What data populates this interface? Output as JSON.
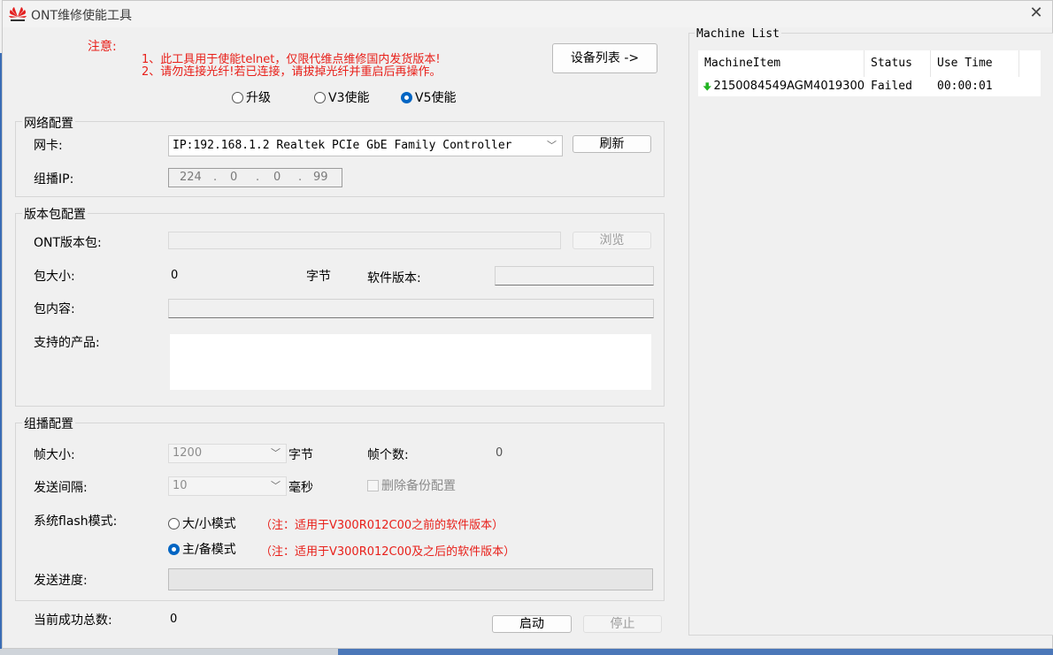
{
  "window": {
    "title": "ONT维修使能工具",
    "brand_color": "#e41e1e"
  },
  "notice": {
    "label": "注意:",
    "line1": "1、此工具用于使能telnet，仅限代维点维修国内发货版本!",
    "line2": "2、请勿连接光纤!若已连接，请拔掉光纤并重启后再操作。"
  },
  "device_list_button": "设备列表 ->",
  "mode": {
    "options": [
      "升级",
      "V3使能",
      "V5使能"
    ],
    "selected": "V5使能"
  },
  "network": {
    "group_title": "网络配置",
    "nic_label": "网卡:",
    "nic_value": "IP:192.168.1.2 Realtek PCIe GbE Family Controller",
    "refresh_button": "刷新",
    "multicast_label": "组播IP:",
    "ip_octets": [
      "224",
      "0",
      "0",
      "99"
    ],
    "ip_dot": "."
  },
  "package": {
    "group_title": "版本包配置",
    "ont_label": "ONT版本包:",
    "browse_button": "浏览",
    "size_label": "包大小:",
    "size_value": "0",
    "size_unit": "字节",
    "software_version_label": "软件版本:",
    "content_label": "包内容:",
    "supported_label": "支持的产品:"
  },
  "multicast": {
    "group_title": "组播配置",
    "frame_size_label": "帧大小:",
    "frame_size_value": "1200",
    "frame_size_unit": "字节",
    "frame_count_label": "帧个数:",
    "frame_count_value": "0",
    "interval_label": "发送间隔:",
    "interval_value": "10",
    "interval_unit": "毫秒",
    "delete_backup_label": "删除备份配置",
    "flash_mode_label": "系统flash模式:",
    "flash_options": [
      {
        "label": "大/小模式",
        "note": "（注：适用于V300R012C00之前的软件版本）",
        "selected": false
      },
      {
        "label": "主/备模式",
        "note": "（注：适用于V300R012C00及之后的软件版本）",
        "selected": true
      }
    ],
    "progress_label": "发送进度:",
    "progress": 0
  },
  "footer": {
    "success_total_label": "当前成功总数:",
    "success_total_value": "0",
    "start_button": "启动",
    "stop_button": "停止"
  },
  "machine_list": {
    "title": "Machine List",
    "columns": [
      "MachineItem",
      "Status",
      "Use Time"
    ],
    "rows": [
      {
        "icon": "green-down-arrow-icon",
        "item": "2150084549AGM4019300",
        "status": "Failed",
        "time": "00:00:01"
      }
    ],
    "status_icon_color": "#22b422"
  }
}
